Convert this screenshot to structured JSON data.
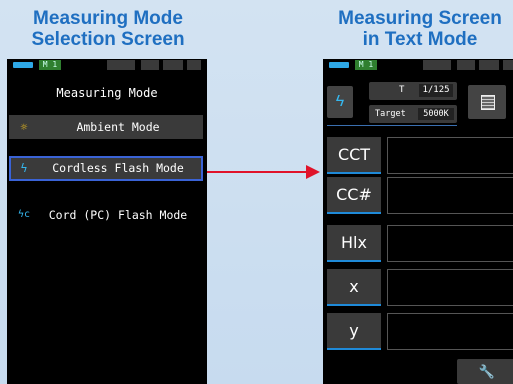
{
  "left_caption": [
    "Measuring Mode",
    "Selection Screen"
  ],
  "right_caption": [
    "Measuring Screen",
    "in Text Mode"
  ],
  "left_screen": {
    "memory": "M 1",
    "title": "Measuring Mode",
    "modes": [
      {
        "icon": "☼",
        "label": "Ambient Mode",
        "selected": false
      },
      {
        "icon": "ϟ",
        "label": "Cordless Flash Mode",
        "selected": true
      },
      {
        "icon": "ϟc",
        "label": "Cord (PC) Flash Mode",
        "selected": false
      }
    ]
  },
  "right_screen": {
    "memory": "M 1",
    "shutter_label": "T",
    "shutter_value": "1/125",
    "target_label": "Target",
    "target_value": "5000K",
    "rows": [
      "CCT",
      "CC#",
      "Hlx",
      "x",
      "y"
    ],
    "tool_icon": "wrench-icon"
  },
  "colors": {
    "caption": "#1f6fc1",
    "accent_blue": "#35b8f0",
    "selection_border": "#3a63d6",
    "arrow": "#e0132a"
  }
}
